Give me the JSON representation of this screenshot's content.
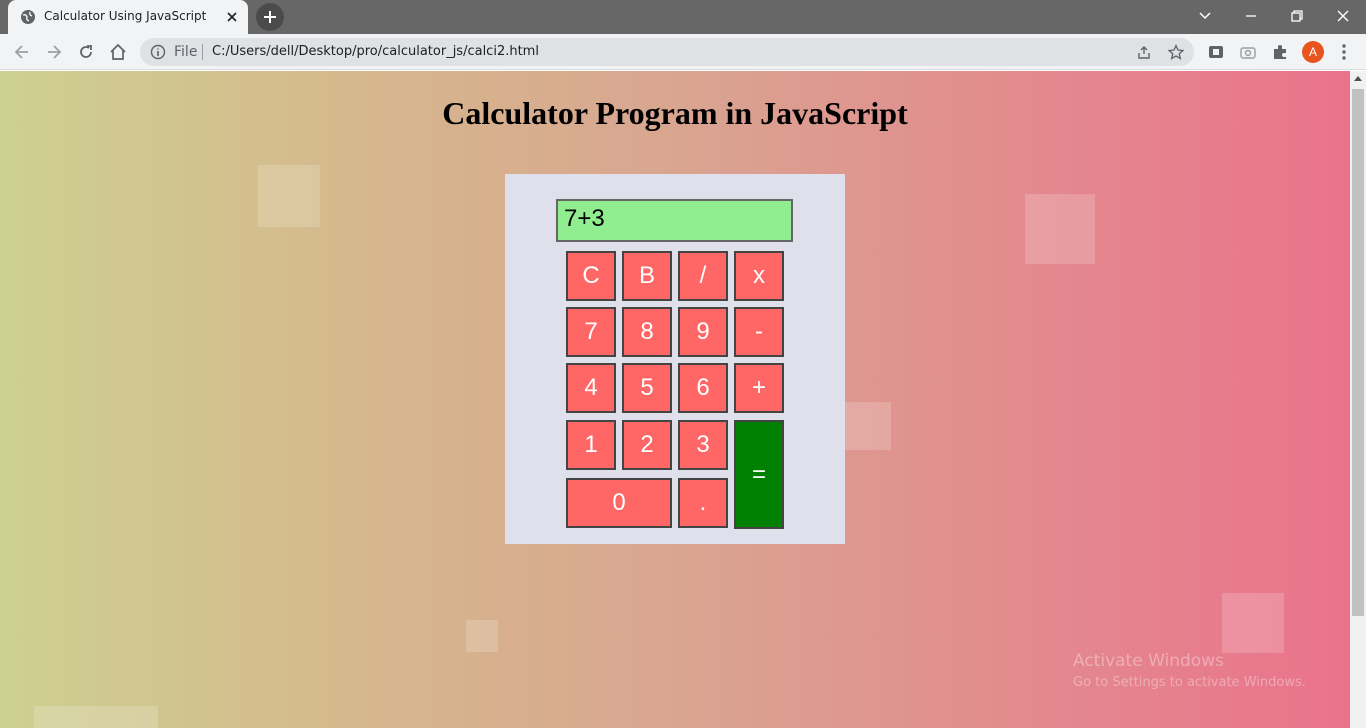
{
  "browser": {
    "tab_title": "Calculator Using JavaScript",
    "omnibox_scheme": "File",
    "url": "C:/Users/dell/Desktop/pro/calculator_js/calci2.html",
    "profile_initial": "A",
    "icons": [
      "globe-icon",
      "close-icon",
      "plus-icon",
      "chevron-down-icon",
      "minimize-icon",
      "restore-icon",
      "window-close-icon",
      "back-arrow-icon",
      "forward-arrow-icon",
      "reload-icon",
      "home-icon",
      "info-icon",
      "share-icon",
      "star-icon",
      "extension-icon",
      "camera-icon",
      "puzzle-icon",
      "more-vert-icon"
    ]
  },
  "page": {
    "title": "Calculator Program in JavaScript",
    "display_value": "7+3",
    "keys": {
      "clear": "C",
      "back": "B",
      "divide": "/",
      "multiply": "x",
      "seven": "7",
      "eight": "8",
      "nine": "9",
      "minus": "-",
      "four": "4",
      "five": "5",
      "six": "6",
      "plus": "+",
      "one": "1",
      "two": "2",
      "three": "3",
      "equals": "=",
      "zero": "0",
      "dot": "."
    },
    "colors": {
      "key": "#ff6666",
      "equals_key": "#008000",
      "display": "#90ee90",
      "calculator_bg": "#e0e0ec"
    }
  },
  "os_watermark": {
    "title": "Activate Windows",
    "subtitle": "Go to Settings to activate Windows."
  }
}
